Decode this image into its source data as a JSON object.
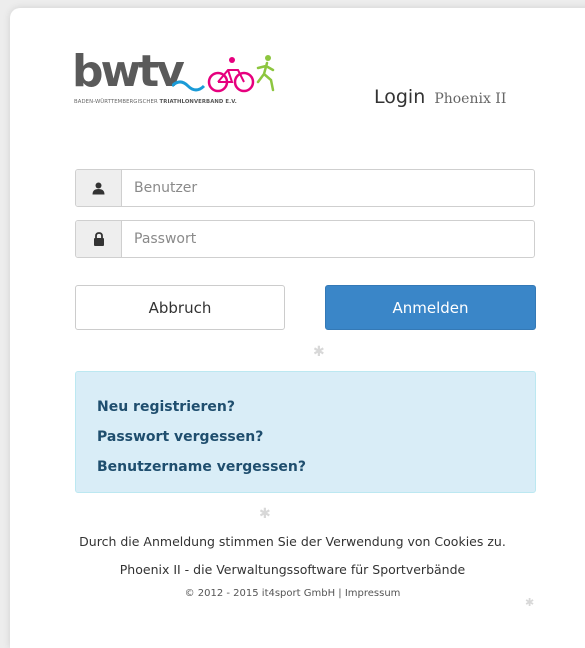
{
  "logo": {
    "text": "bwtv",
    "subtitle_plain": "BADEN-WÜRTTEMBERGISCHER",
    "subtitle_bold": "TRIATHLONVERBAND E.V.",
    "colors": {
      "text": "#5a5a5a",
      "swim": "#1a9bd7",
      "bike": "#e6007e",
      "run": "#8dc63f"
    }
  },
  "header": {
    "title": "Login",
    "subtitle": "Phoenix II"
  },
  "form": {
    "username_placeholder": "Benutzer",
    "password_placeholder": "Passwort",
    "username_icon": "user-icon",
    "password_icon": "lock-icon"
  },
  "buttons": {
    "cancel_label": "Abbruch",
    "login_label": "Anmelden"
  },
  "links": {
    "register": "Neu registrieren?",
    "forgot_password": "Passwort vergessen?",
    "forgot_username": "Benutzername vergessen?"
  },
  "footer": {
    "cookie_notice": "Durch die Anmeldung stimmen Sie der Verwendung von Cookies zu.",
    "tagline": "Phoenix II - die Verwaltungssoftware für Sportverbände",
    "copyright": "© 2012 - 2015 it4sport GmbH",
    "separator": "|",
    "impressum": "Impressum"
  },
  "colors": {
    "primary_button": "#3a86c8",
    "info_background": "#d9edf7",
    "info_link": "#1f4e6e"
  }
}
